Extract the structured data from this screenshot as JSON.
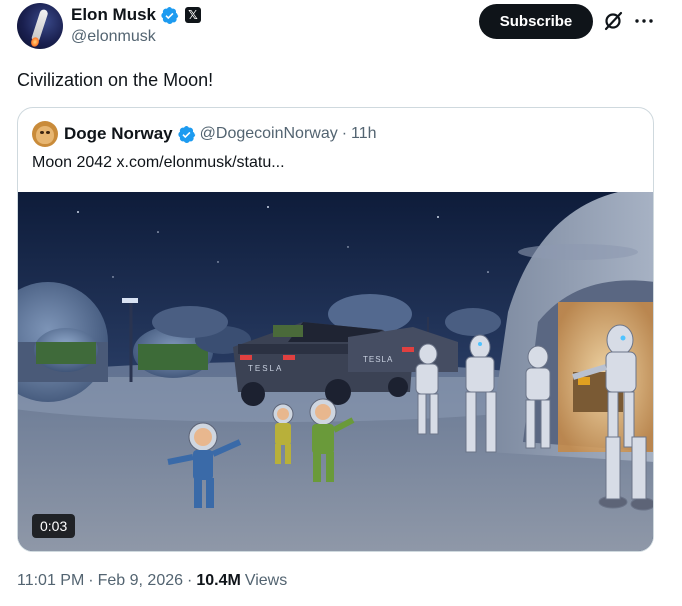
{
  "author": {
    "display_name": "Elon Musk",
    "handle": "@elonmusk",
    "verified": true,
    "affiliation_badge": "𝕏"
  },
  "actions": {
    "subscribe_label": "Subscribe",
    "grok_icon": "grok-icon",
    "more_icon": "more-icon"
  },
  "tweet": {
    "text": "Civilization on the Moon!"
  },
  "quoted_tweet": {
    "display_name": "Doge Norway",
    "handle": "@DogecoinNorway",
    "separator": "·",
    "time": "11h",
    "text": "Moon 2042  x.com/elonmusk/statu...",
    "media": {
      "type": "video",
      "duration": "0:03",
      "vehicle_label_1": "TESLA",
      "vehicle_label_2": "TESLA"
    }
  },
  "meta": {
    "time": "11:01 PM",
    "date": "Feb 9, 2026",
    "separator": "·",
    "views_count": "10.4M",
    "views_label": "Views"
  },
  "colors": {
    "verified_blue": "#1d9bf0",
    "text_primary": "#0f1419",
    "text_secondary": "#536471",
    "border": "#cfd9de"
  }
}
